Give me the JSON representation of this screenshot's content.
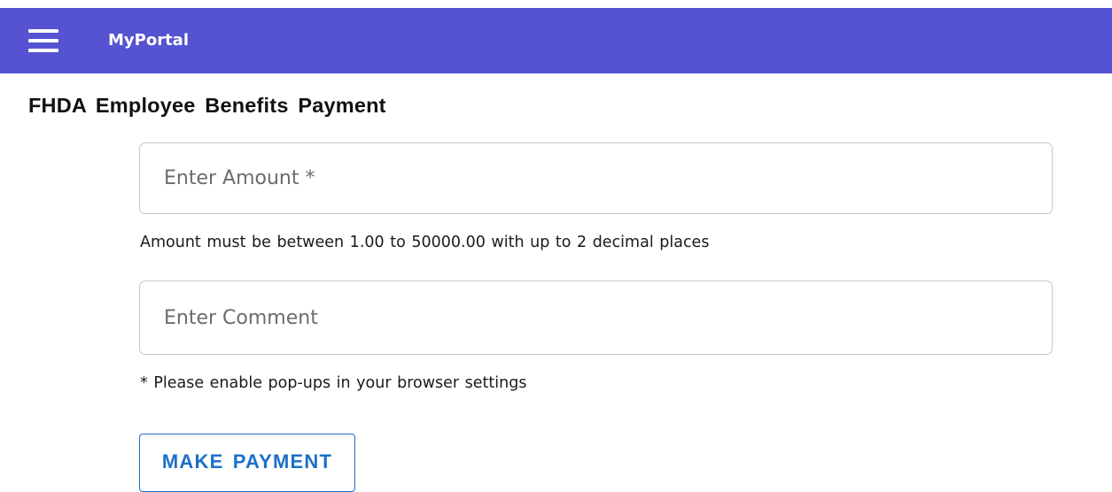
{
  "header": {
    "brand": "MyPortal",
    "menu_icon": "hamburger-menu-icon",
    "bg_color": "#5553d2"
  },
  "page": {
    "title": "FHDA Employee Benefits Payment"
  },
  "form": {
    "amount": {
      "placeholder": "Enter Amount *",
      "value": "",
      "hint": "Amount must be between 1.00 to 50000.00 with up to 2 decimal places"
    },
    "comment": {
      "placeholder": "Enter Comment",
      "value": ""
    },
    "popup_note": "* Please enable pop-ups in your browser settings",
    "submit_label": "MAKE PAYMENT",
    "accent_color": "#1c70c8"
  }
}
